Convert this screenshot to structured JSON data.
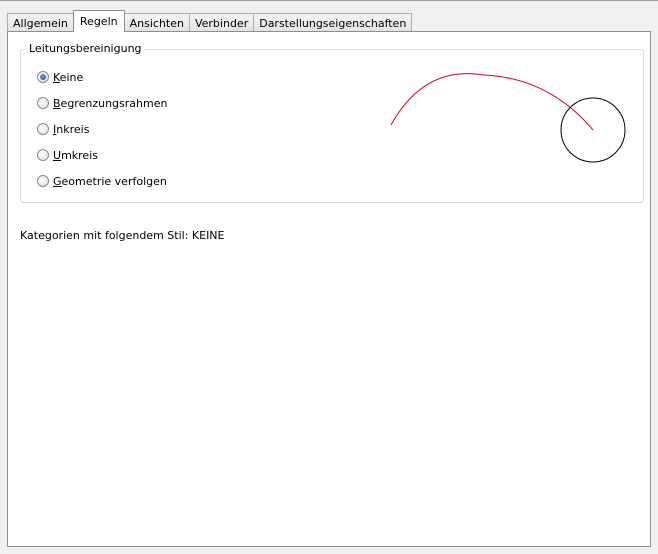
{
  "tabs": [
    {
      "label": "Allgemein"
    },
    {
      "label": "Regeln",
      "active": true
    },
    {
      "label": "Ansichten"
    },
    {
      "label": "Verbinder"
    },
    {
      "label": "Darstellungseigenschaften"
    }
  ],
  "group": {
    "title": "Leitungsbereinigung",
    "options": [
      {
        "mnemonic": "K",
        "rest": "eine",
        "checked": true
      },
      {
        "mnemonic": "B",
        "rest": "egrenzungsrahmen",
        "checked": false
      },
      {
        "mnemonic": "I",
        "rest": "nkreis",
        "checked": false
      },
      {
        "mnemonic": "U",
        "rest": "mkreis",
        "checked": false
      },
      {
        "mnemonic": "G",
        "rest": "eometrie verfolgen",
        "checked": false
      }
    ]
  },
  "preview": {
    "arc_color": "#d0021b",
    "circle_color": "#000000"
  },
  "status": "Kategorien mit folgendem Stil: KEINE"
}
